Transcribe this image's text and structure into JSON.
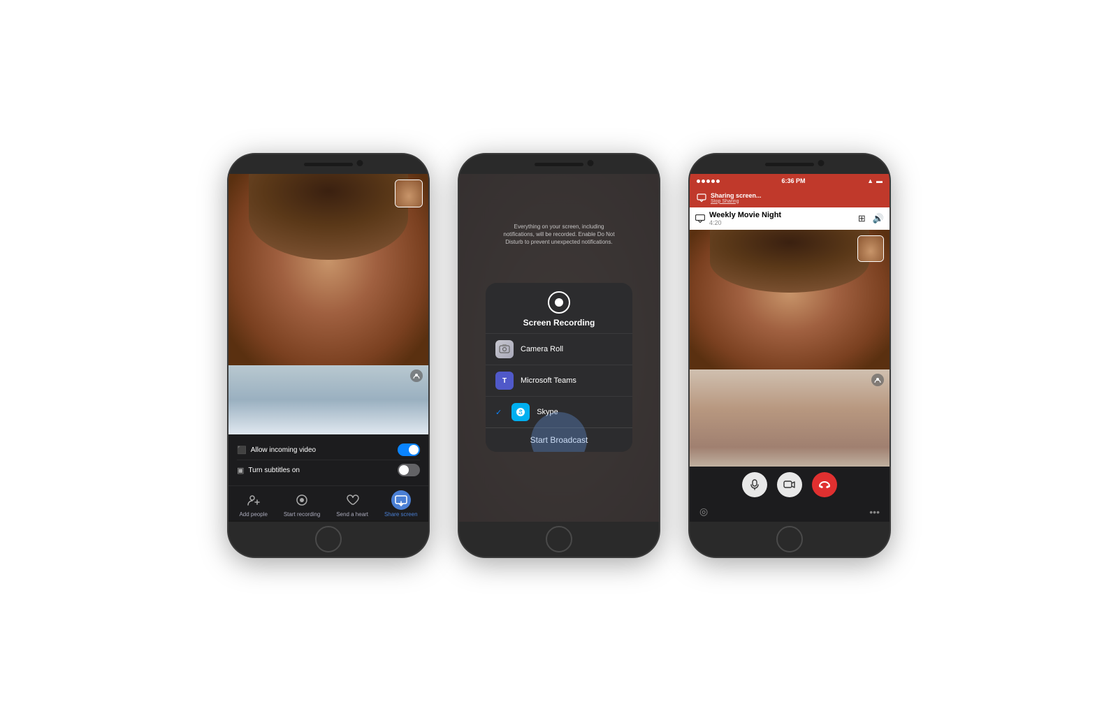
{
  "phones": {
    "phone1": {
      "controls": {
        "toggle1_label": "Allow incoming video",
        "toggle2_label": "Turn subtitles on"
      },
      "nav": {
        "item1": "Add people",
        "item2": "Start recording",
        "item3": "Send a heart",
        "item4": "Share screen"
      }
    },
    "phone2": {
      "hint_text": "Everything on your screen, including notifications, will be recorded. Enable Do Not Disturb to prevent unexpected notifications.",
      "popup": {
        "title": "Screen Recording",
        "option1": "Camera Roll",
        "option2": "Microsoft Teams",
        "option3": "Skype",
        "start_broadcast": "Start Broadcast"
      }
    },
    "phone3": {
      "status_bar": {
        "time": "6:36 PM"
      },
      "sharing_bar": {
        "title": "Sharing screen...",
        "stop": "Stop Sharing"
      },
      "header": {
        "meeting_title": "Weekly Movie Night",
        "duration": "4:20"
      }
    }
  }
}
